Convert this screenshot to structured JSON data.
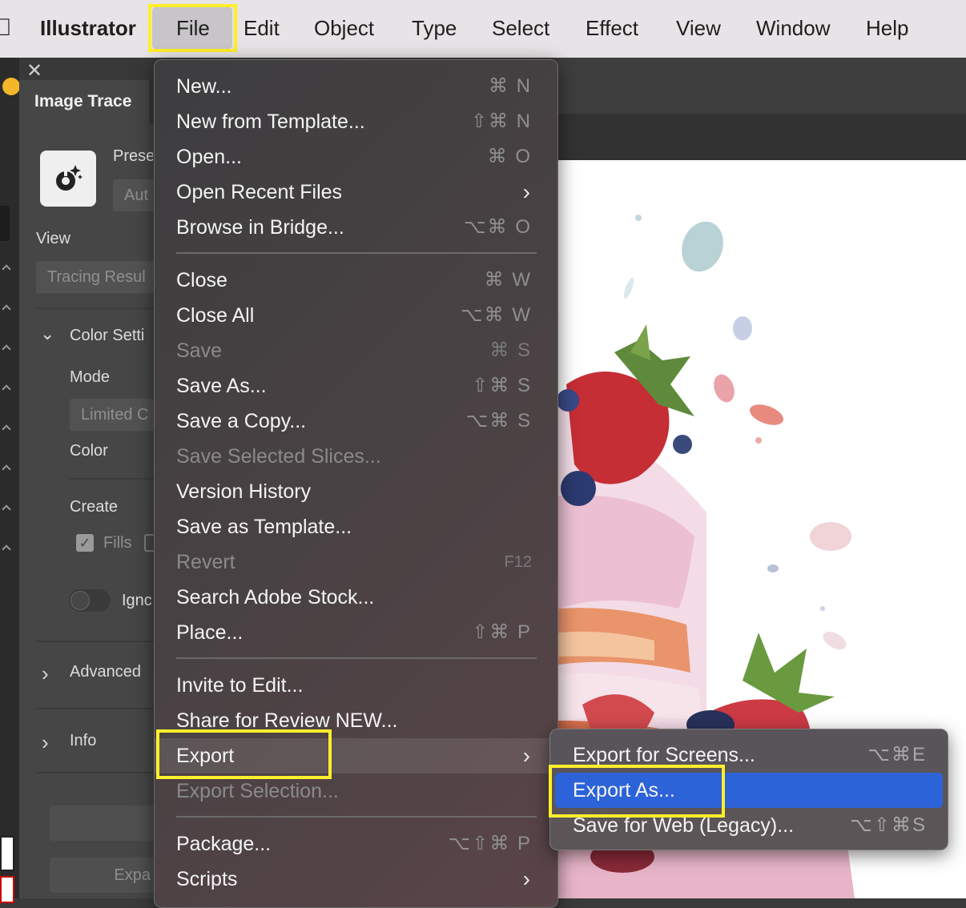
{
  "menubar": {
    "app_name": "Illustrator",
    "items": [
      "File",
      "Edit",
      "Object",
      "Type",
      "Select",
      "Effect",
      "View",
      "Window",
      "Help"
    ]
  },
  "panel": {
    "title": "Image Trace",
    "preset_label": "Prese",
    "preset_value": "Aut",
    "view_label": "View",
    "view_value": "Tracing Resul",
    "color_settings_label": "Color Setti",
    "mode_label": "Mode",
    "mode_value": "Limited C",
    "color_label": "Color",
    "create_label": "Create",
    "fills_label": "Fills",
    "ignore_label": "Ignc",
    "advanced_label": "Advanced",
    "info_label": "Info",
    "expand_label": "Expa"
  },
  "file_menu": {
    "items": [
      {
        "label": "New...",
        "shortcut": "⌘ N"
      },
      {
        "label": "New from Template...",
        "shortcut": "⇧⌘ N"
      },
      {
        "label": "Open...",
        "shortcut": "⌘ O"
      },
      {
        "label": "Open Recent Files",
        "shortcut": "›"
      },
      {
        "label": "Browse in Bridge...",
        "shortcut": "⌥⌘ O"
      },
      {
        "label": "Close",
        "shortcut": "⌘ W"
      },
      {
        "label": "Close All",
        "shortcut": "⌥⌘ W"
      },
      {
        "label": "Save",
        "shortcut": "⌘ S"
      },
      {
        "label": "Save As...",
        "shortcut": "⇧⌘ S"
      },
      {
        "label": "Save a Copy...",
        "shortcut": "⌥⌘ S"
      },
      {
        "label": "Save Selected Slices...",
        "shortcut": ""
      },
      {
        "label": "Version History",
        "shortcut": ""
      },
      {
        "label": "Save as Template...",
        "shortcut": ""
      },
      {
        "label": "Revert",
        "shortcut": "F12"
      },
      {
        "label": "Search Adobe Stock...",
        "shortcut": ""
      },
      {
        "label": "Place...",
        "shortcut": "⇧⌘ P"
      },
      {
        "label": "Invite to Edit...",
        "shortcut": ""
      },
      {
        "label": "Share for Review NEW...",
        "shortcut": ""
      },
      {
        "label": "Export",
        "shortcut": "›"
      },
      {
        "label": "Export Selection...",
        "shortcut": ""
      },
      {
        "label": "Package...",
        "shortcut": "⌥⇧⌘ P"
      },
      {
        "label": "Scripts",
        "shortcut": "›"
      }
    ]
  },
  "export_submenu": {
    "items": [
      {
        "label": "Export for Screens...",
        "shortcut": "⌥⌘E"
      },
      {
        "label": "Export As...",
        "shortcut": ""
      },
      {
        "label": "Save for Web (Legacy)...",
        "shortcut": "⌥⇧⌘S"
      }
    ]
  },
  "colors": {
    "highlight_box": "#ffef2b",
    "selection_blue": "#2d63d8"
  }
}
